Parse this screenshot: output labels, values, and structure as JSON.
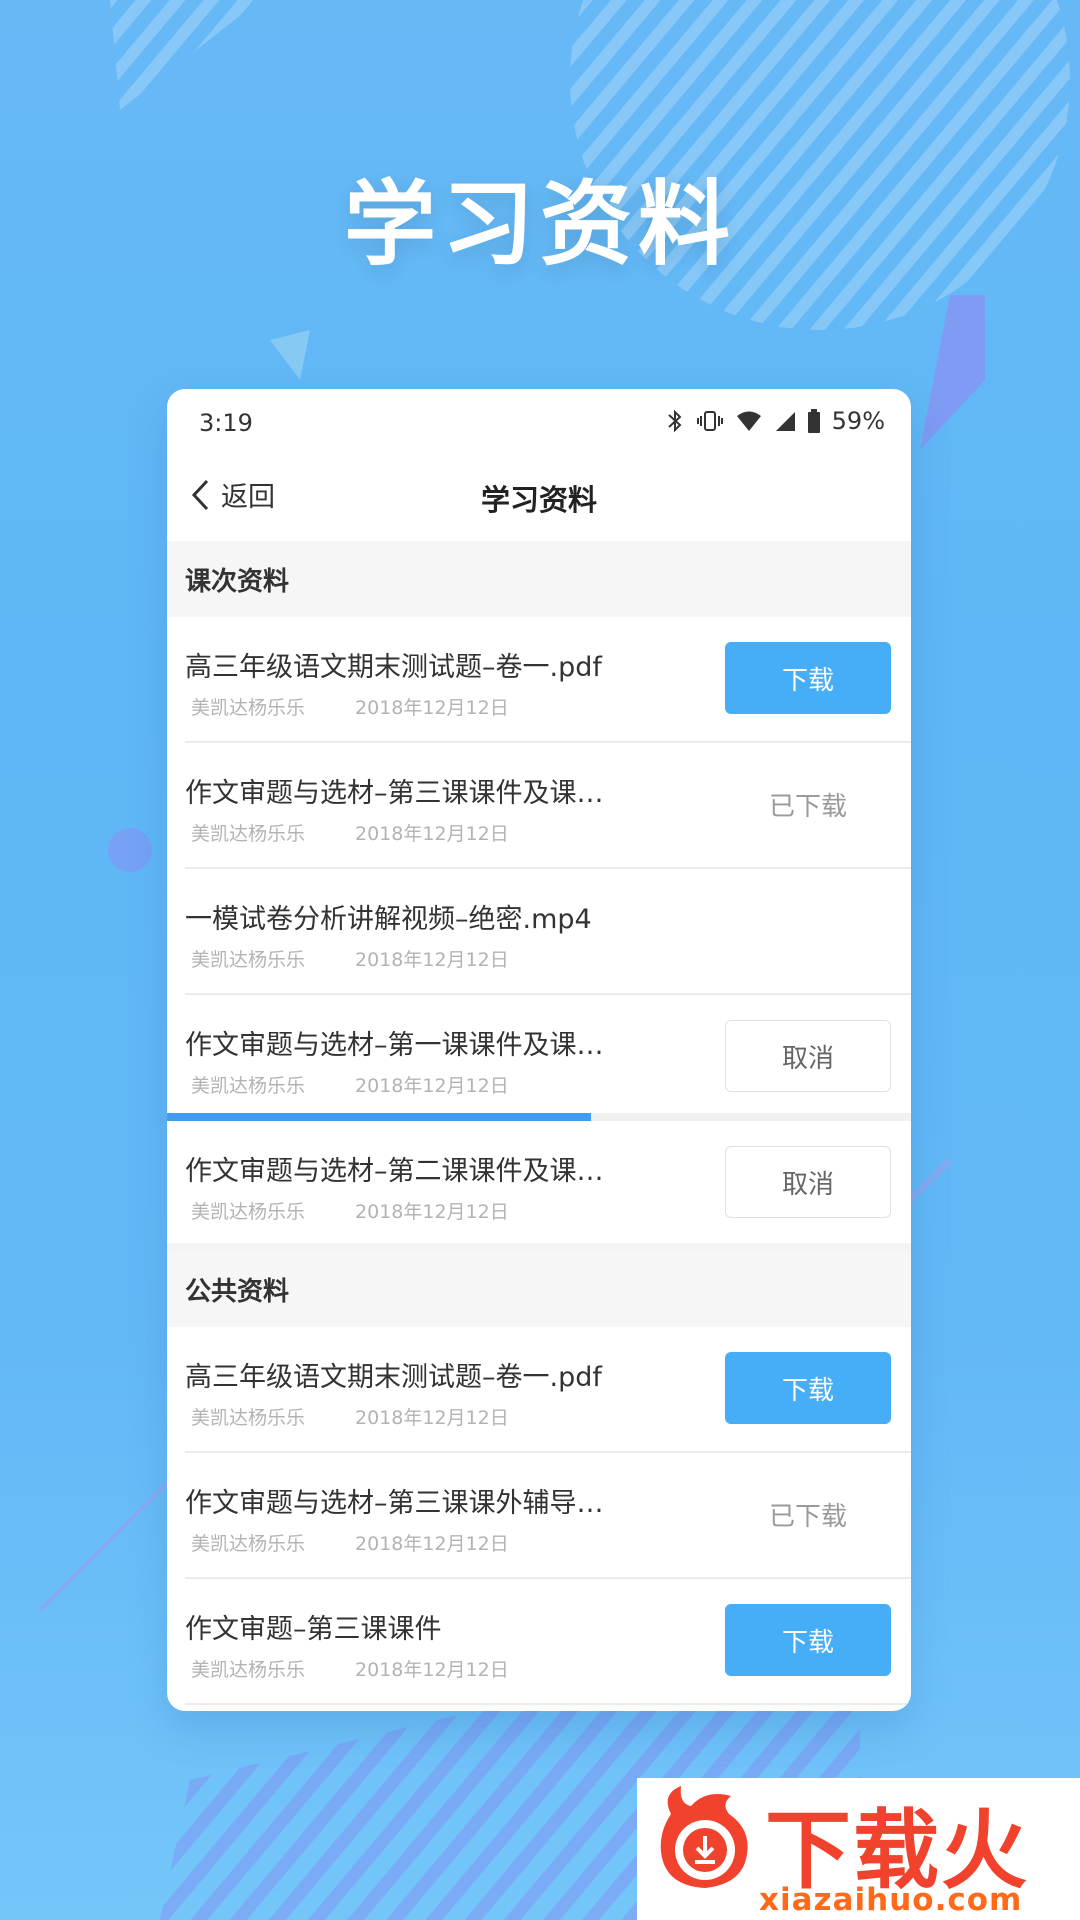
{
  "promo": {
    "title": "学习资料"
  },
  "statusbar": {
    "time": "3:19",
    "battery": "59%"
  },
  "navbar": {
    "back_label": "返回",
    "title": "学习资料"
  },
  "sections": [
    {
      "title": "课次资料",
      "items": [
        {
          "name": "高三年级语文期末测试题–卷一.pdf",
          "author": "美凯达杨乐乐",
          "date": "2018年12月12日",
          "action": "下载",
          "action_type": "download"
        },
        {
          "name": "作文审题与选材–第三课课件及课…",
          "author": "美凯达杨乐乐",
          "date": "2018年12月12日",
          "action": "已下载",
          "action_type": "done"
        },
        {
          "name": "一模试卷分析讲解视频–绝密.mp4",
          "author": "美凯达杨乐乐",
          "date": "2018年12月12日",
          "action": "",
          "action_type": "none"
        },
        {
          "name": "作文审题与选材–第一课课件及课…",
          "author": "美凯达杨乐乐",
          "date": "2018年12月12日",
          "action": "取消",
          "action_type": "cancel",
          "progress": 0.57
        },
        {
          "name": "作文审题与选材–第二课课件及课…",
          "author": "美凯达杨乐乐",
          "date": "2018年12月12日",
          "action": "取消",
          "action_type": "cancel"
        }
      ]
    },
    {
      "title": "公共资料",
      "items": [
        {
          "name": "高三年级语文期末测试题–卷一.pdf",
          "author": "美凯达杨乐乐",
          "date": "2018年12月12日",
          "action": "下载",
          "action_type": "download"
        },
        {
          "name": "作文审题与选材–第三课课外辅导…",
          "author": "美凯达杨乐乐",
          "date": "2018年12月12日",
          "action": "已下载",
          "action_type": "done"
        },
        {
          "name": "作文审题–第三课课件",
          "author": "美凯达杨乐乐",
          "date": "2018年12月12日",
          "action": "下载",
          "action_type": "download"
        }
      ]
    }
  ],
  "watermark": {
    "title": "下载火",
    "url": "xiazaihuo.com"
  },
  "colors": {
    "accent": "#46aef6",
    "progress": "#3f9ef2",
    "watermark": "#f0422c"
  }
}
